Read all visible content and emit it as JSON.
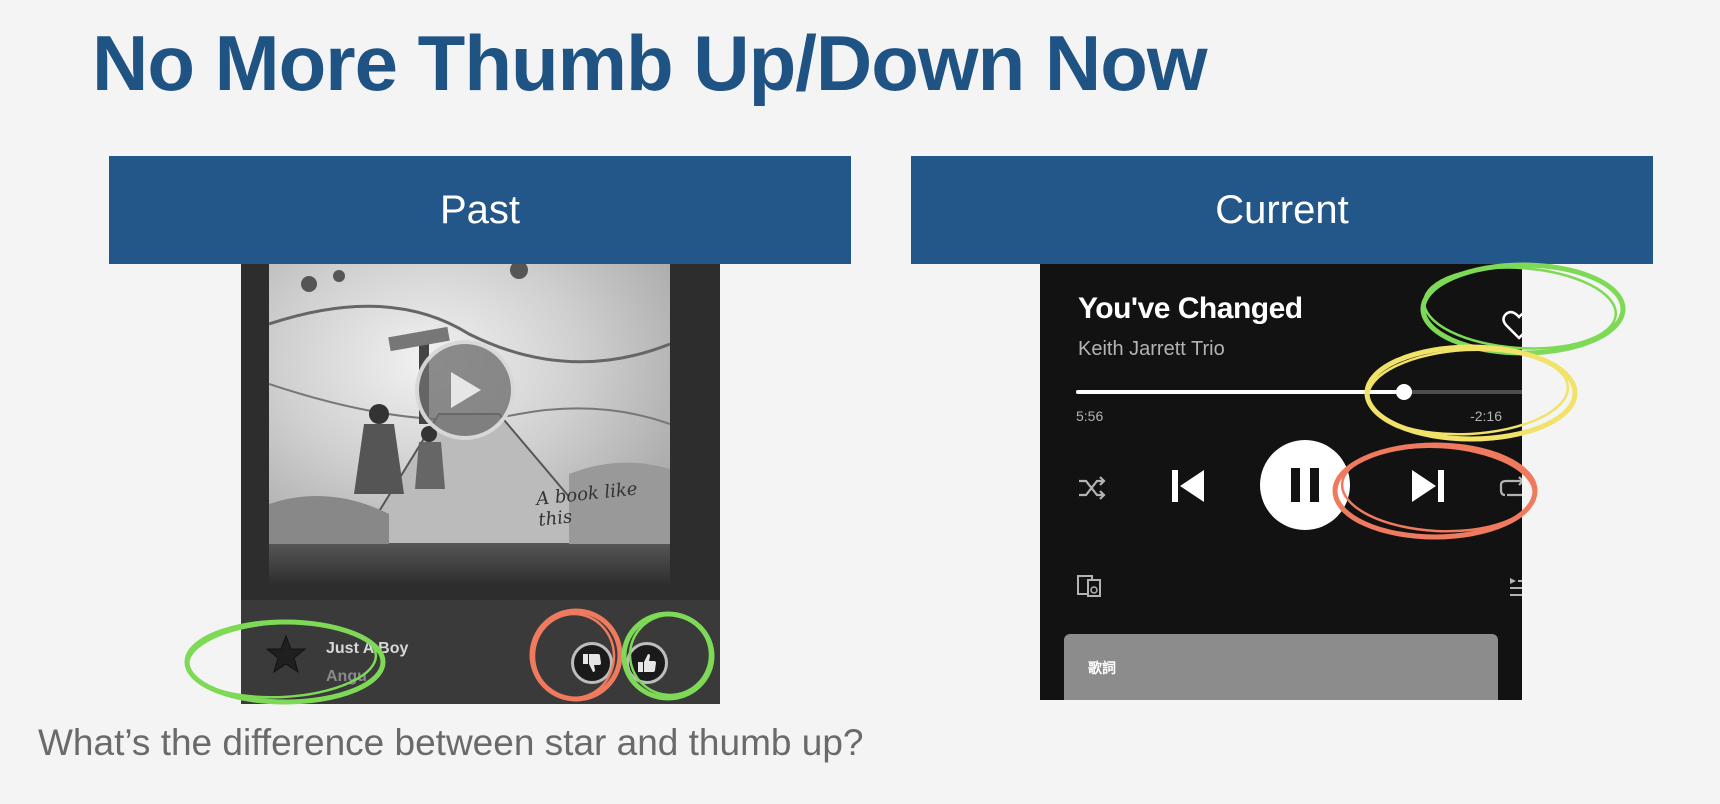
{
  "slide": {
    "title": "No More Thumb Up/Down Now",
    "caption": "What’s the difference between star and thumb up?"
  },
  "past": {
    "header": "Past",
    "album_caption": "A book like this",
    "track_title": "Just A Boy",
    "track_artist": "Angu",
    "icons": [
      "play-icon",
      "star-icon",
      "thumb-down-icon",
      "thumb-up-icon"
    ]
  },
  "current": {
    "header": "Current",
    "song_title": "You've Changed",
    "artist": "Keith Jarrett Trio",
    "elapsed": "5:56",
    "remaining": "-2:16",
    "progress": 0.71,
    "lyrics_label": "歌詞",
    "icons": [
      "heart-icon",
      "shuffle-icon",
      "previous-icon",
      "pause-icon",
      "next-icon",
      "repeat-icon",
      "devices-icon",
      "queue-icon"
    ]
  },
  "colors": {
    "title_blue": "#1f5384",
    "header_band": "#235789",
    "annotation_green": "#7ed957",
    "annotation_red": "#ef7a5e",
    "annotation_yellow": "#f1e26a"
  }
}
